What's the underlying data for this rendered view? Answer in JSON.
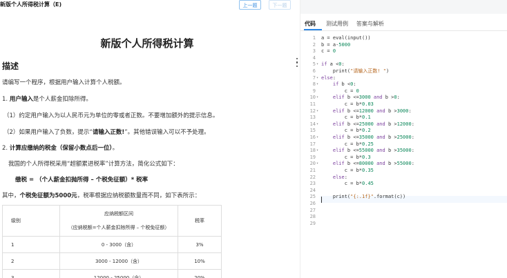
{
  "header": {
    "doc_title": "新版个人所得税计算（E)",
    "prev_label": "上一题",
    "next_label": "下一题"
  },
  "problem": {
    "title": "新版个人所得税计算",
    "desc_heading": "描述",
    "intro": "请编写一个程序，根据用户输入计算个人税额。",
    "item1_num": "1.",
    "item1_bold": "用户输入",
    "item1_rest": "是个人薪金扣除所得。",
    "sub1": "（1）约定用户输入为以人民币元为单位的零或者正数。不要增加额外的提示信息。",
    "sub2_pre": "（2）如果用户输入了负数，提示“",
    "sub2_bold": "请输入正数!",
    "sub2_post": "”。其他错误输入可以不予处理。",
    "item2_num": "2.",
    "item2_bold": "计算应缴纳的税金（保留小数点后一位）",
    "item2_post": "。",
    "method": "我国的个人所得税采用“超额累进税率”计算方法，简化公式如下：",
    "formula": "缴税 = （个人薪金扣抛所得 – 个税免征额）* 税率",
    "note_pre": "其中，",
    "note_bold": "个税免征额为5000元",
    "note_post": "，税率根据应纳税额数量而不同，如下表所示：",
    "table": {
      "col_level": "级别",
      "col_range_1": "应纳税额区间",
      "col_range_2": "（应纳税额=个人薪金扣除所得 – 个税免征额）",
      "col_rate": "税率",
      "rows": [
        {
          "level": "1",
          "range": "0 - 3000（含）",
          "rate": "3%"
        },
        {
          "level": "2",
          "range": "3000 - 12000（含）",
          "rate": "10%"
        },
        {
          "level": "3",
          "range": "12000 - 25000（含）",
          "rate": "20%"
        }
      ]
    }
  },
  "tabs": {
    "code": "代码",
    "tests": "测试用例",
    "answer": "答案与解析"
  },
  "editor": {
    "line_numbers": [
      "1",
      "2",
      "3",
      "4",
      "5",
      "6",
      "7",
      "8",
      "9",
      "10",
      "11",
      "12",
      "13",
      "14",
      "15",
      "16",
      "17",
      "18",
      "19",
      "20",
      "21",
      "22",
      "23",
      "24",
      "25",
      "26",
      "27",
      "28",
      "29"
    ],
    "lines": [
      "a = eval(input())",
      "b = a-5000",
      "c = 0",
      "",
      "if a <0:",
      "    print(\"请输入正数! \")",
      "else:",
      "    if b <0:",
      "        c = 0",
      "    elif b <=3000 and b >0:",
      "        c = b*0.03",
      "    elif b <=12000 and b >3000:",
      "        c = b*0.1",
      "    elif b <=25000 and b >12000:",
      "        c = b*0.2",
      "    elif b <=35000 and b >25000:",
      "        c = b*0.25",
      "    elif b <=55000 and b >35000:",
      "        c = b*0.3",
      "    elif b <=80000 and b >55000:",
      "        c = b*0.35",
      "    else:",
      "        c = b*0.45",
      "",
      "    print(\"{:.1f}\".format(c))",
      "",
      "",
      "",
      ""
    ]
  },
  "colors": {
    "accent": "#2b86e6",
    "keyword": "#7a3e9d",
    "string": "#b5651d",
    "number": "#098658"
  },
  "icons": [
    "fold-arrow-icon",
    "drag-handle-icon"
  ]
}
